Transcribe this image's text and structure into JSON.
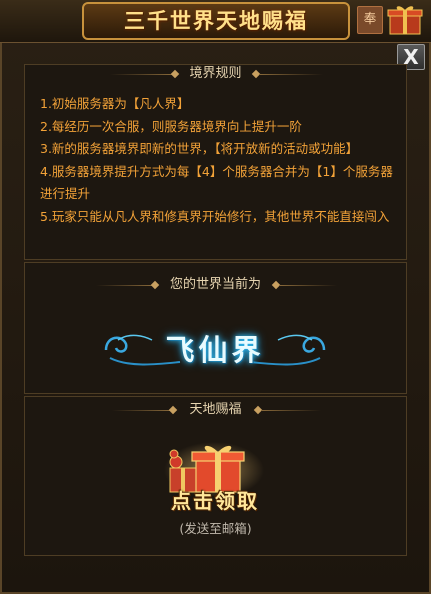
{
  "window": {
    "title": "三千世界天地赐福",
    "seal_glyph": "奉",
    "close_glyph": "X"
  },
  "rules": {
    "heading": "境界规则",
    "items": [
      "1.初始服务器为【凡人界】",
      "2.每经历一次合服，则服务器境界向上提升一阶",
      "3.新的服务器境界即新的世界，【将开放新的活动或功能】",
      "4.服务器境界提升方式为每【4】个服务器合并为【1】个服务器进行提升",
      "5.玩家只能从凡人界和修真界开始修行，其他世界不能直接闯入"
    ]
  },
  "current_world": {
    "heading": "您的世界当前为",
    "realm_name": "飞仙界"
  },
  "blessing": {
    "heading": "天地赐福",
    "claim_label": "点击领取",
    "claim_note": "(发送至邮箱)"
  },
  "colors": {
    "rule_text": "#f2a238",
    "title_gold": "#ffe08a",
    "realm_glow": "#35c8ff"
  },
  "icons": {
    "corner": "gift-box-icon",
    "close": "close-icon",
    "gift": "gift-box-icon"
  }
}
